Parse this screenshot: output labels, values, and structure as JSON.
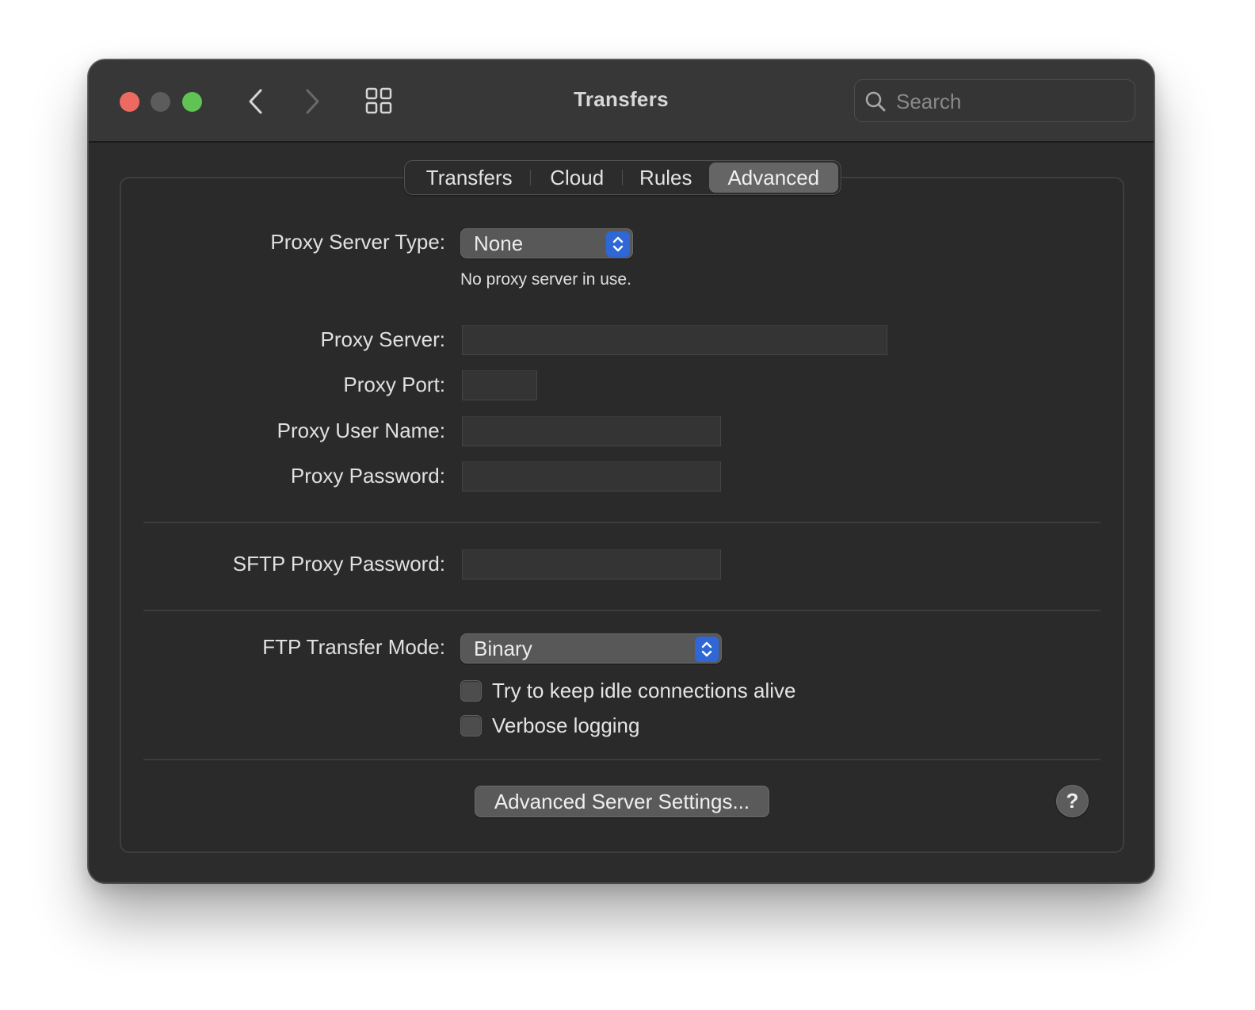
{
  "window": {
    "title": "Transfers",
    "search_placeholder": "Search"
  },
  "toolbar": {
    "back_icon": "chevron-left-icon",
    "forward_icon": "chevron-right-icon",
    "grid_icon": "grid-icon"
  },
  "tabs": [
    {
      "label": "Transfers",
      "selected": false
    },
    {
      "label": "Cloud",
      "selected": false
    },
    {
      "label": "Rules",
      "selected": false
    },
    {
      "label": "Advanced",
      "selected": true
    }
  ],
  "proxy": {
    "type_label": "Proxy Server Type:",
    "type_value": "None",
    "type_hint": "No proxy server in use.",
    "server_label": "Proxy Server:",
    "server_value": "",
    "port_label": "Proxy Port:",
    "port_value": "",
    "user_label": "Proxy User Name:",
    "user_value": "",
    "password_label": "Proxy Password:",
    "password_value": ""
  },
  "sftp": {
    "password_label": "SFTP Proxy Password:",
    "password_value": ""
  },
  "ftp": {
    "mode_label": "FTP Transfer Mode:",
    "mode_value": "Binary",
    "keep_alive_label": "Try to keep idle connections alive",
    "keep_alive_checked": false,
    "verbose_label": "Verbose logging",
    "verbose_checked": false
  },
  "footer": {
    "advanced_button": "Advanced Server Settings...",
    "help_label": "?"
  },
  "colors": {
    "close": "#ec6a5f",
    "minimize": "#5c5c5c",
    "zoom": "#5fc454",
    "accent": "#2f67d6"
  }
}
